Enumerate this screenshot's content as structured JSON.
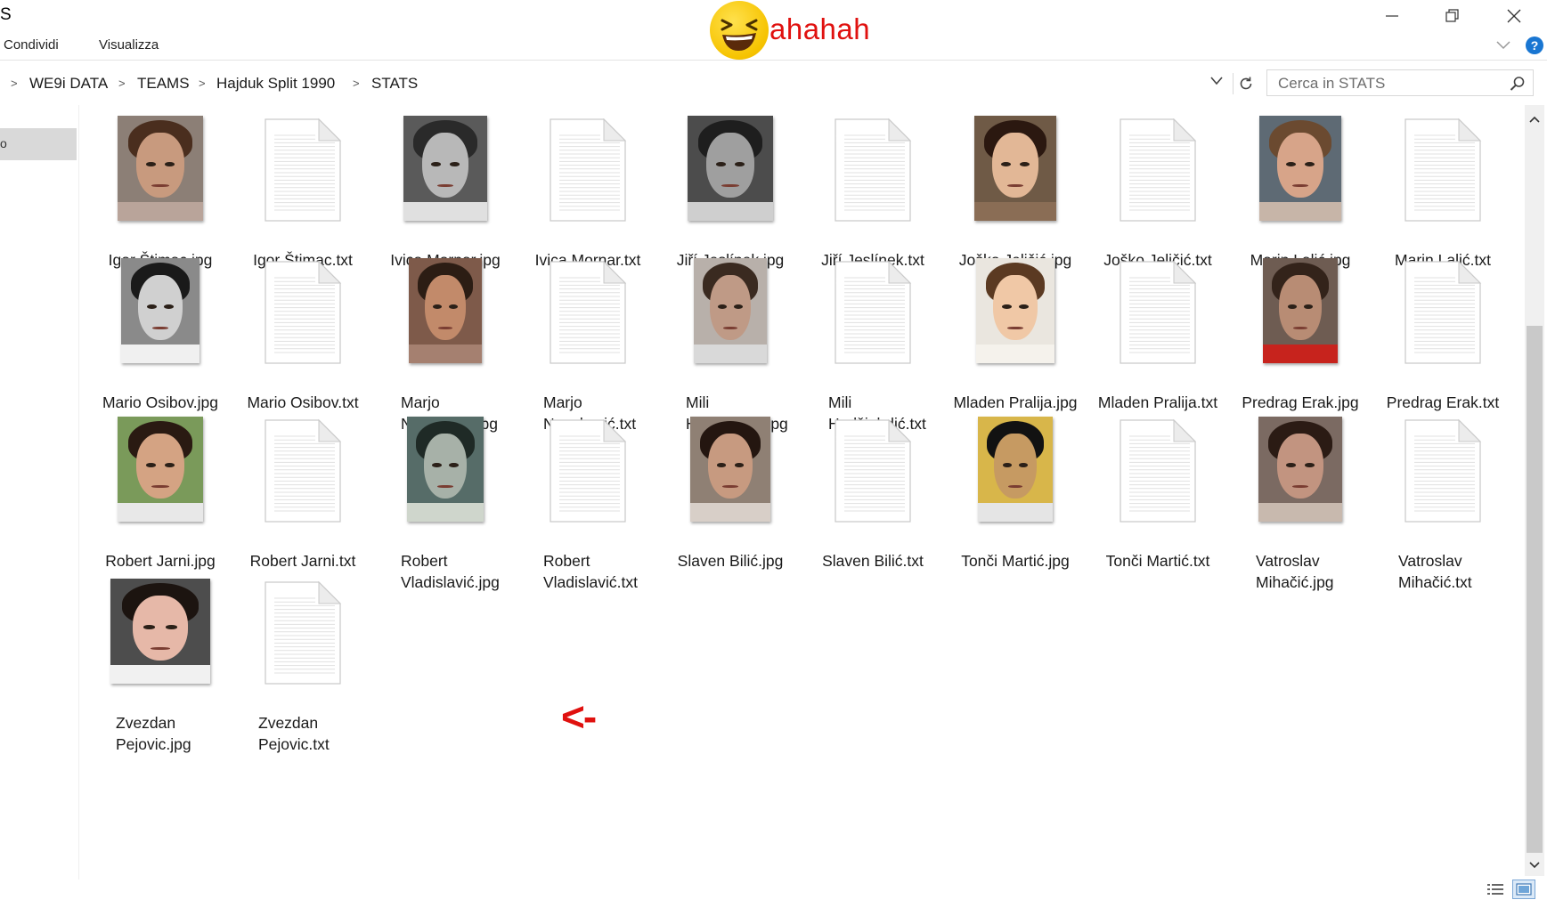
{
  "window": {
    "title": "S",
    "minimize_label": "minimize",
    "maximize_label": "restore",
    "close_label": "close"
  },
  "ribbon": {
    "tabs": [
      "Condividi",
      "Visualizza"
    ],
    "help": "?"
  },
  "overlay": {
    "text": "ahahah",
    "arrow": "<-",
    "color": "#e0110f"
  },
  "address": {
    "crumbs": [
      "WE9i DATA",
      "TEAMS",
      "Hajduk Split 1990",
      "STATS"
    ]
  },
  "search": {
    "placeholder": "Cerca in STATS"
  },
  "nav": {
    "selected_label": "o"
  },
  "files": [
    {
      "name": "Igor Štimac.jpg",
      "type": "jpg"
    },
    {
      "name": "Igor Štimac.txt",
      "type": "txt"
    },
    {
      "name": "Ivica Mornar.jpg",
      "type": "jpg"
    },
    {
      "name": "Ivica Mornar.txt",
      "type": "txt"
    },
    {
      "name": "Jiří Jeslínek.jpg",
      "type": "jpg"
    },
    {
      "name": "Jiří Jeslínek.txt",
      "type": "txt"
    },
    {
      "name": "Joško Jeličić.jpg",
      "type": "jpg"
    },
    {
      "name": "Joško Jeličić.txt",
      "type": "txt"
    },
    {
      "name": "Marin Lalić.jpg",
      "type": "jpg"
    },
    {
      "name": "Marin Lalić.txt",
      "type": "txt"
    },
    {
      "name": "Mario Osibov.jpg",
      "type": "jpg"
    },
    {
      "name": "Mario Osibov.txt",
      "type": "txt"
    },
    {
      "name": "Marjo Novaković.jpg",
      "type": "jpg"
    },
    {
      "name": "Marjo Novaković.txt",
      "type": "txt"
    },
    {
      "name": "Mili Hadžiabdić.jpg",
      "type": "jpg"
    },
    {
      "name": "Mili Hadžiabdić.txt",
      "type": "txt"
    },
    {
      "name": "Mladen Pralija.jpg",
      "type": "jpg"
    },
    {
      "name": "Mladen Pralija.txt",
      "type": "txt"
    },
    {
      "name": "Predrag Erak.jpg",
      "type": "jpg"
    },
    {
      "name": "Predrag Erak.txt",
      "type": "txt"
    },
    {
      "name": "Robert Jarni.jpg",
      "type": "jpg"
    },
    {
      "name": "Robert Jarni.txt",
      "type": "txt"
    },
    {
      "name": "Robert Vladislavić.jpg",
      "type": "jpg"
    },
    {
      "name": "Robert Vladislavić.txt",
      "type": "txt"
    },
    {
      "name": "Slaven Bilić.jpg",
      "type": "jpg"
    },
    {
      "name": "Slaven Bilić.txt",
      "type": "txt"
    },
    {
      "name": "Tonči Martić.jpg",
      "type": "jpg"
    },
    {
      "name": "Tonči Martić.txt",
      "type": "txt"
    },
    {
      "name": "Vatroslav Mihačić.jpg",
      "type": "jpg"
    },
    {
      "name": "Vatroslav Mihačić.txt",
      "type": "txt"
    },
    {
      "name": "Zvezdan Pejovic.jpg",
      "type": "jpg"
    },
    {
      "name": "Zvezdan Pejovic.txt",
      "type": "txt"
    }
  ],
  "icons": {
    "document": "document-icon",
    "photo": "image-thumbnail",
    "refresh": "refresh-icon",
    "search": "search-icon",
    "dropdown": "chevron-down-icon",
    "details_view": "details-view-icon",
    "large_icons_view": "large-icons-view-icon"
  }
}
